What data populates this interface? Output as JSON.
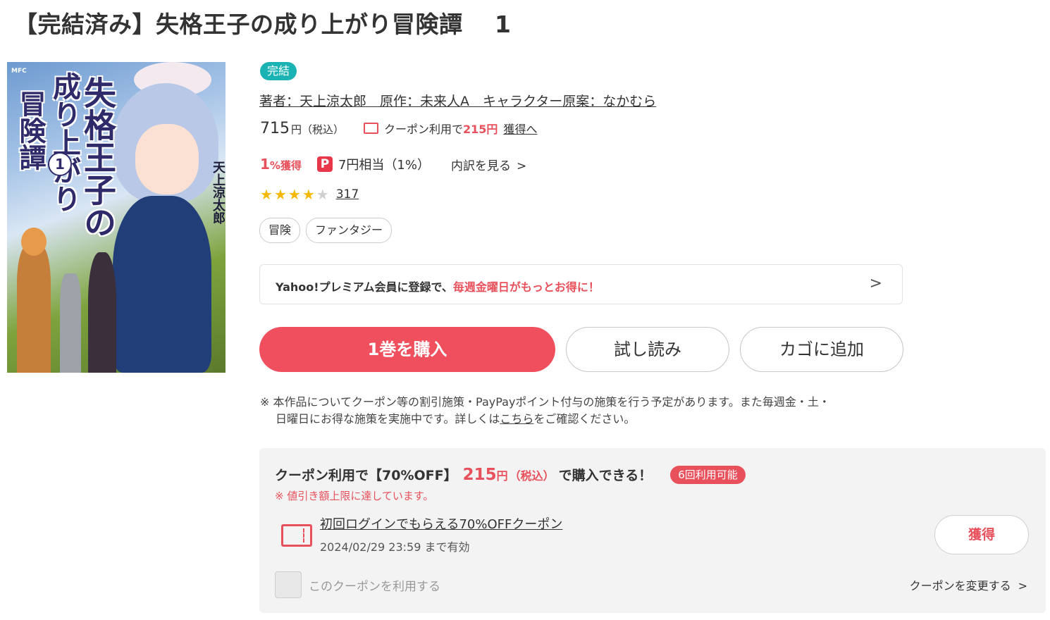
{
  "page": {
    "title": "【完結済み】失格王子の成り上がり冒険譚　 1"
  },
  "cover": {
    "logo": "MFC",
    "title_line1": "成り上がり",
    "title_line2": "失格王子の",
    "title_line3": "冒険譚",
    "volume": "1",
    "author": "天上涼太郎"
  },
  "product": {
    "status_badge": "完結",
    "credits": "著者：天上涼太郎　原作：未来人A　キャラクター原案：なかむら",
    "price": "715",
    "price_unit": "円（税込）",
    "coupon_inline_prefix": "クーポン利用で",
    "coupon_inline_price": "215円",
    "coupon_inline_link": "獲得へ",
    "points_rate": "1",
    "points_rate_suffix": "%獲得",
    "paypay_icon_glyph": "P",
    "points_value": "7円相当（1%）",
    "points_detail": "内訳を見る",
    "rating": 4,
    "rating_max": 5,
    "review_count": "317",
    "tags": [
      "冒険",
      "ファンタジー"
    ]
  },
  "yahoo_banner": {
    "text_black": "Yahoo!プレミアム会員に登録で、",
    "text_red": "毎週金曜日がもっとお得に！",
    "chevron": "＞"
  },
  "actions": {
    "buy": "1巻を購入",
    "trial": "試し読み",
    "cart": "カゴに追加"
  },
  "notice": {
    "line1": "※ 本作品についてクーポン等の割引施策・PayPayポイント付与の施策を行う予定があります。また毎週金・土・",
    "line2_before": "日曜日にお得な施策を実施中です。詳しくは",
    "line2_link": "こちら",
    "line2_after": "をご確認ください。"
  },
  "coupon_box": {
    "lead": "クーポン利用で【70%OFF】",
    "price": "215",
    "yen": "円",
    "tax": "（税込）",
    "tail": "で購入できる！",
    "badge": "6回利用可能",
    "limit_note": "※ 値引き額上限に達しています。",
    "coupon_name": "初回ログインでもらえる70%OFFクーポン",
    "expiry": "2024/02/29 23:59 まで有効",
    "get_button": "獲得",
    "checkbox_label": "このクーポンを利用する",
    "change_link": "クーポンを変更する"
  },
  "colors": {
    "accent_red": "#f0505e",
    "status_teal": "#1ab2b2",
    "star_gold": "#f5b800"
  },
  "icons": {
    "coupon": "ticket-icon",
    "paypay": "paypay-icon",
    "chevron": "chevron-right-icon",
    "star": "star-icon"
  }
}
